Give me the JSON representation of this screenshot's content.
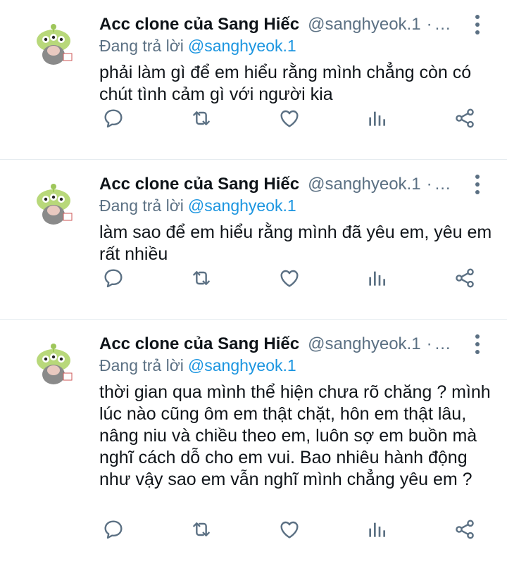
{
  "colors": {
    "name": "#0f1419",
    "secondary": "#5b7083",
    "mention": "#1b95e0",
    "divider": "#e6ecf0"
  },
  "tweets": [
    {
      "name": "Acc clone của Sang Hiếc",
      "handle": "@sanghyeok.1",
      "dot": "·",
      "ellipsis": "...",
      "reply_prefix": "Đang trả lời",
      "reply_to": "@sanghyeok.1",
      "text": "phải làm gì để em hiểu rằng mình chẳng còn có chút tình cảm gì với người kia"
    },
    {
      "name": "Acc clone của Sang Hiếc",
      "handle": "@sanghyeok.1",
      "dot": "·",
      "ellipsis": "...",
      "reply_prefix": "Đang trả lời",
      "reply_to": "@sanghyeok.1",
      "text": "làm sao để em hiểu rằng mình đã yêu em, yêu em rất nhiều"
    },
    {
      "name": "Acc clone của Sang Hiếc",
      "handle": "@sanghyeok.1",
      "dot": "·",
      "ellipsis": "...",
      "reply_prefix": "Đang trả lời",
      "reply_to": "@sanghyeok.1",
      "text": "thời gian qua mình thể hiện chưa rõ chăng ? mình lúc nào cũng ôm em thật chặt, hôn em thật lâu, nâng niu và chiều theo em, luôn sợ em buồn mà nghĩ cách dỗ cho em vui. Bao nhiêu hành động như vậy sao em vẫn nghĩ mình chẳng yêu em ?"
    }
  ],
  "action_icons": [
    "reply-icon",
    "retweet-icon",
    "like-icon",
    "analytics-icon",
    "share-icon"
  ]
}
